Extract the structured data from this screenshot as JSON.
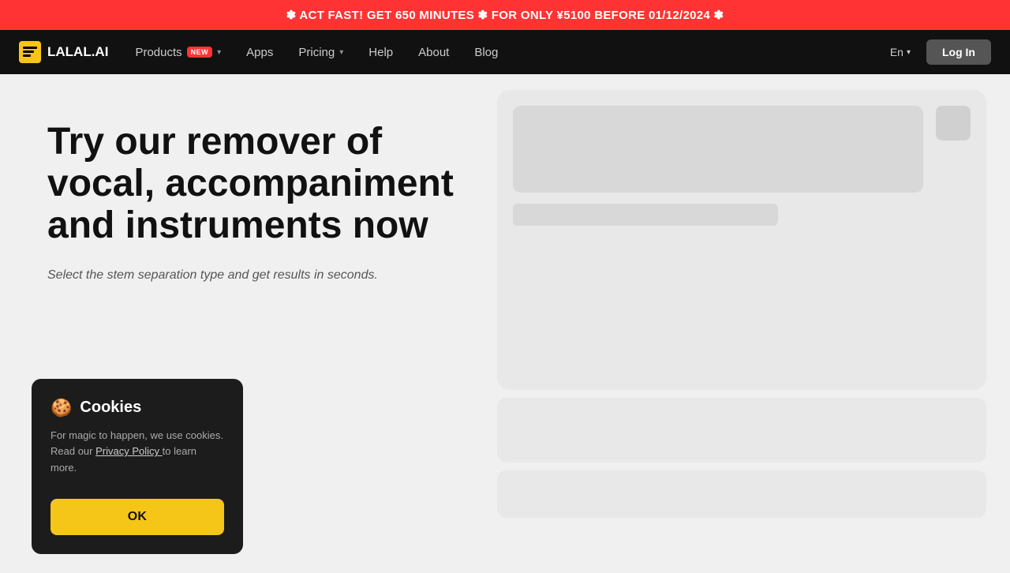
{
  "banner": {
    "text": "✽ ACT FAST! GET 650 MINUTES ✽ FOR ONLY ¥5100 BEFORE 01/12/2024 ✽"
  },
  "nav": {
    "logo_text": "LALAL.AI",
    "logo_icon": "≡",
    "items": [
      {
        "id": "products",
        "label": "Products",
        "badge": "NEW",
        "has_dropdown": true
      },
      {
        "id": "apps",
        "label": "Apps",
        "has_dropdown": false
      },
      {
        "id": "pricing",
        "label": "Pricing",
        "has_dropdown": true
      },
      {
        "id": "help",
        "label": "Help",
        "has_dropdown": false
      },
      {
        "id": "about",
        "label": "About",
        "has_dropdown": false
      },
      {
        "id": "blog",
        "label": "Blog",
        "has_dropdown": false
      }
    ],
    "lang": "En",
    "login_label": "Log In"
  },
  "hero": {
    "title": "Try our remover of vocal, accompaniment and instruments now",
    "subtitle": "Select the stem separation type and get results in seconds."
  },
  "cookie": {
    "icon": "🍪",
    "title": "Cookies",
    "text": "For magic to happen, we use cookies. Read our",
    "link_text": "Privacy Policy",
    "text_after": "to learn more.",
    "ok_label": "OK"
  }
}
